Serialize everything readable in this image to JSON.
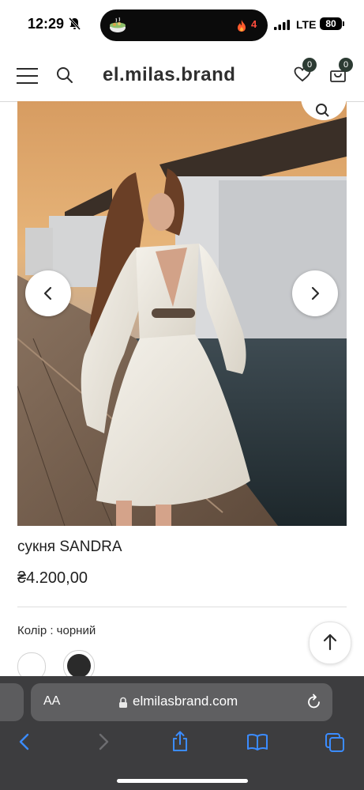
{
  "status_bar": {
    "time": "12:29",
    "network": "LTE",
    "battery": "80",
    "activity_count": "4",
    "icons": [
      "bell-slash-icon",
      "food-bowl-icon",
      "fire-icon",
      "signal-icon",
      "battery-icon"
    ]
  },
  "header": {
    "brand": "el.milas.brand",
    "wishlist_count": "0",
    "cart_count": "0",
    "icons": [
      "hamburger-menu-icon",
      "search-icon",
      "heart-icon",
      "shopping-bag-icon"
    ]
  },
  "product": {
    "title": "сукня SANDRA",
    "price": "₴4.200,00",
    "color_label": "Колір : чорний",
    "color_options": [
      "white",
      "black"
    ],
    "selected_color": "black",
    "swatch_colors": {
      "white": "#ffffff",
      "black": "#2a2a2a"
    },
    "gallery_icons": [
      "zoom-icon",
      "chevron-left-icon",
      "chevron-right-icon"
    ]
  },
  "browser": {
    "text_size_label": "AA",
    "url": "elmilasbrand.com",
    "icons": [
      "lock-icon",
      "reload-icon",
      "back-icon",
      "forward-icon",
      "share-icon",
      "bookmarks-icon",
      "tabs-icon"
    ]
  },
  "colors": {
    "accent_badge": "#2c3b33",
    "toolbar_bg": "#3d3d3f",
    "toolbar_blue": "#3b8cff"
  }
}
